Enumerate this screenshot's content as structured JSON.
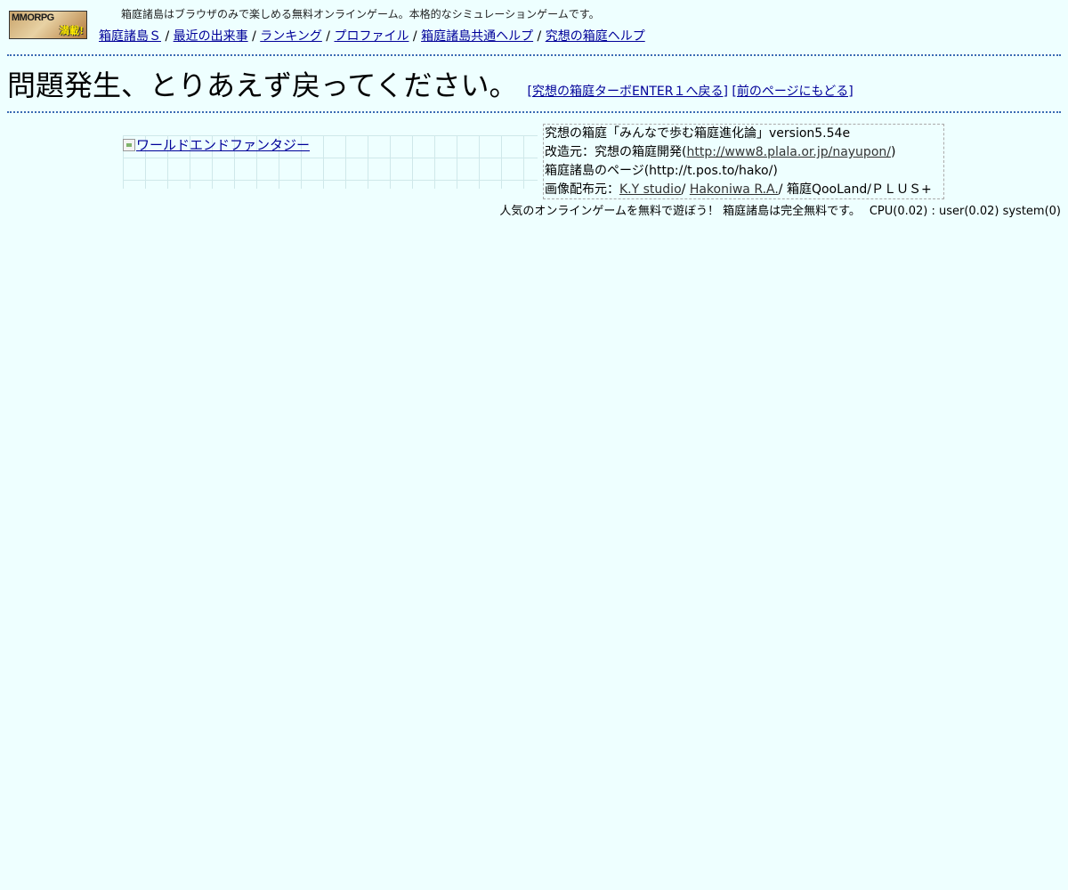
{
  "banner": {
    "main": "MMORPG",
    "sub": "満載!"
  },
  "tagline": "箱庭諸島はブラウザのみで楽しめる無料オンラインゲーム。本格的なシミュレーションゲームです。",
  "nav": {
    "items": [
      "箱庭諸島Ｓ",
      "最近の出来事",
      "ランキング",
      "プロファイル",
      "箱庭諸島共通ヘルプ",
      "究想の箱庭ヘルプ"
    ],
    "separator": "/"
  },
  "error": {
    "message": "問題発生、とりあえず戻ってください。",
    "back_turbo": "[究想の箱庭ターボENTER１へ戻る]",
    "back_prev": "[前のページにもどる]"
  },
  "ad": {
    "alt_text": "ワールドエンドファンタジー"
  },
  "credits": {
    "version": "究想の箱庭「みんなで歩む箱庭進化論」version5.54e",
    "origin_label": "改造元：究想の箱庭開発(",
    "origin_link": "http://www8.plala.or.jp/nayupon/",
    "origin_close": ")",
    "hako_page": "箱庭諸島のページ(http://t.pos.to/hako/)",
    "image_label": "画像配布元：",
    "image_link_1": "K.Y studio",
    "image_sep_1": "/ ",
    "image_link_2": "Hakoniwa R.A.",
    "image_rest": "/ 箱庭QooLand/ＰＬＵＳ+"
  },
  "footer": {
    "promo": "人気のオンラインゲームを無料で遊ぼう！ 箱庭諸島は完全無料です。",
    "cpu": "CPU(0.02) : user(0.02) system(0)"
  }
}
